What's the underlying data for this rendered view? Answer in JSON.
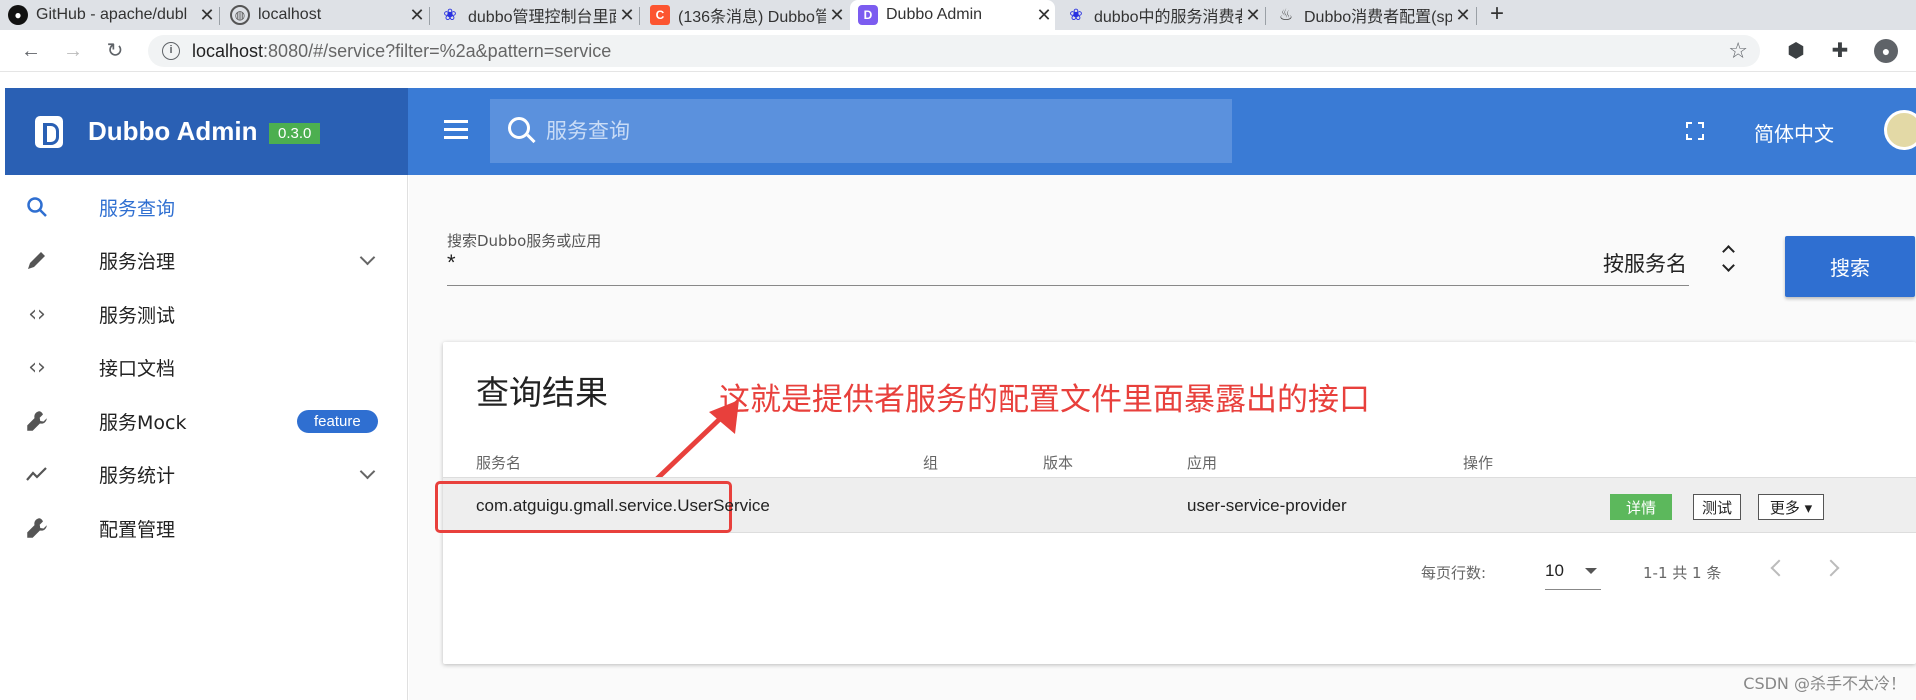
{
  "browser": {
    "tabs": [
      {
        "title": "GitHub - apache/dubl",
        "favicon": "github-icon"
      },
      {
        "title": "localhost",
        "favicon": "globe-icon"
      },
      {
        "title": "dubbo管理控制台里面",
        "favicon": "baidu-icon"
      },
      {
        "title": "(136条消息) Dubbo管",
        "favicon": "csdn-icon"
      },
      {
        "title": "Dubbo Admin",
        "favicon": "dubbo-icon"
      },
      {
        "title": "dubbo中的服务消费者",
        "favicon": "baidu-icon"
      },
      {
        "title": "Dubbo消费者配置(spr",
        "favicon": "spring-icon"
      }
    ],
    "new_tab": "+",
    "url_host": "localhost",
    "url_path": ":8080/#/service?filter=%2a&pattern=service"
  },
  "brand": {
    "name": "Dubbo Admin",
    "version": "0.3.0"
  },
  "topbar": {
    "search_placeholder": "服务查询",
    "language": "简体中文"
  },
  "sidebar": {
    "items": [
      {
        "label": "服务查询",
        "icon": "search-icon",
        "active": true
      },
      {
        "label": "服务治理",
        "icon": "pencil-icon",
        "expandable": true
      },
      {
        "label": "服务测试",
        "icon": "code-icon"
      },
      {
        "label": "接口文档",
        "icon": "code-icon"
      },
      {
        "label": "服务Mock",
        "icon": "wrench-icon",
        "badge": "feature"
      },
      {
        "label": "服务统计",
        "icon": "trending-icon",
        "expandable": true
      },
      {
        "label": "配置管理",
        "icon": "wrench-icon"
      }
    ]
  },
  "search": {
    "field_label": "搜索Dubbo服务或应用",
    "field_value": "*",
    "select_value": "按服务名",
    "button": "搜索"
  },
  "results": {
    "title": "查询结果",
    "annotation": "这就是提供者服务的配置文件里面暴露出的接口",
    "columns": {
      "service": "服务名",
      "group": "组",
      "version": "版本",
      "app": "应用",
      "ops": "操作"
    },
    "rows": [
      {
        "service": "com.atguigu.gmall.service.UserService",
        "group": "",
        "version": "",
        "app": "user-service-provider"
      }
    ],
    "actions": {
      "detail": "详情",
      "test": "测试",
      "more": "更多 ▾"
    },
    "pager": {
      "rows_label": "每页行数:",
      "rows_value": "10",
      "range": "1-1 共 1 条"
    }
  },
  "watermark": "CSDN @杀手不太冷！",
  "colors": {
    "brand": "#2a60b4",
    "topbar": "#3a7bd5",
    "accent": "#2f6fd1",
    "success": "#5cb85c",
    "annotation": "#e8403c"
  }
}
